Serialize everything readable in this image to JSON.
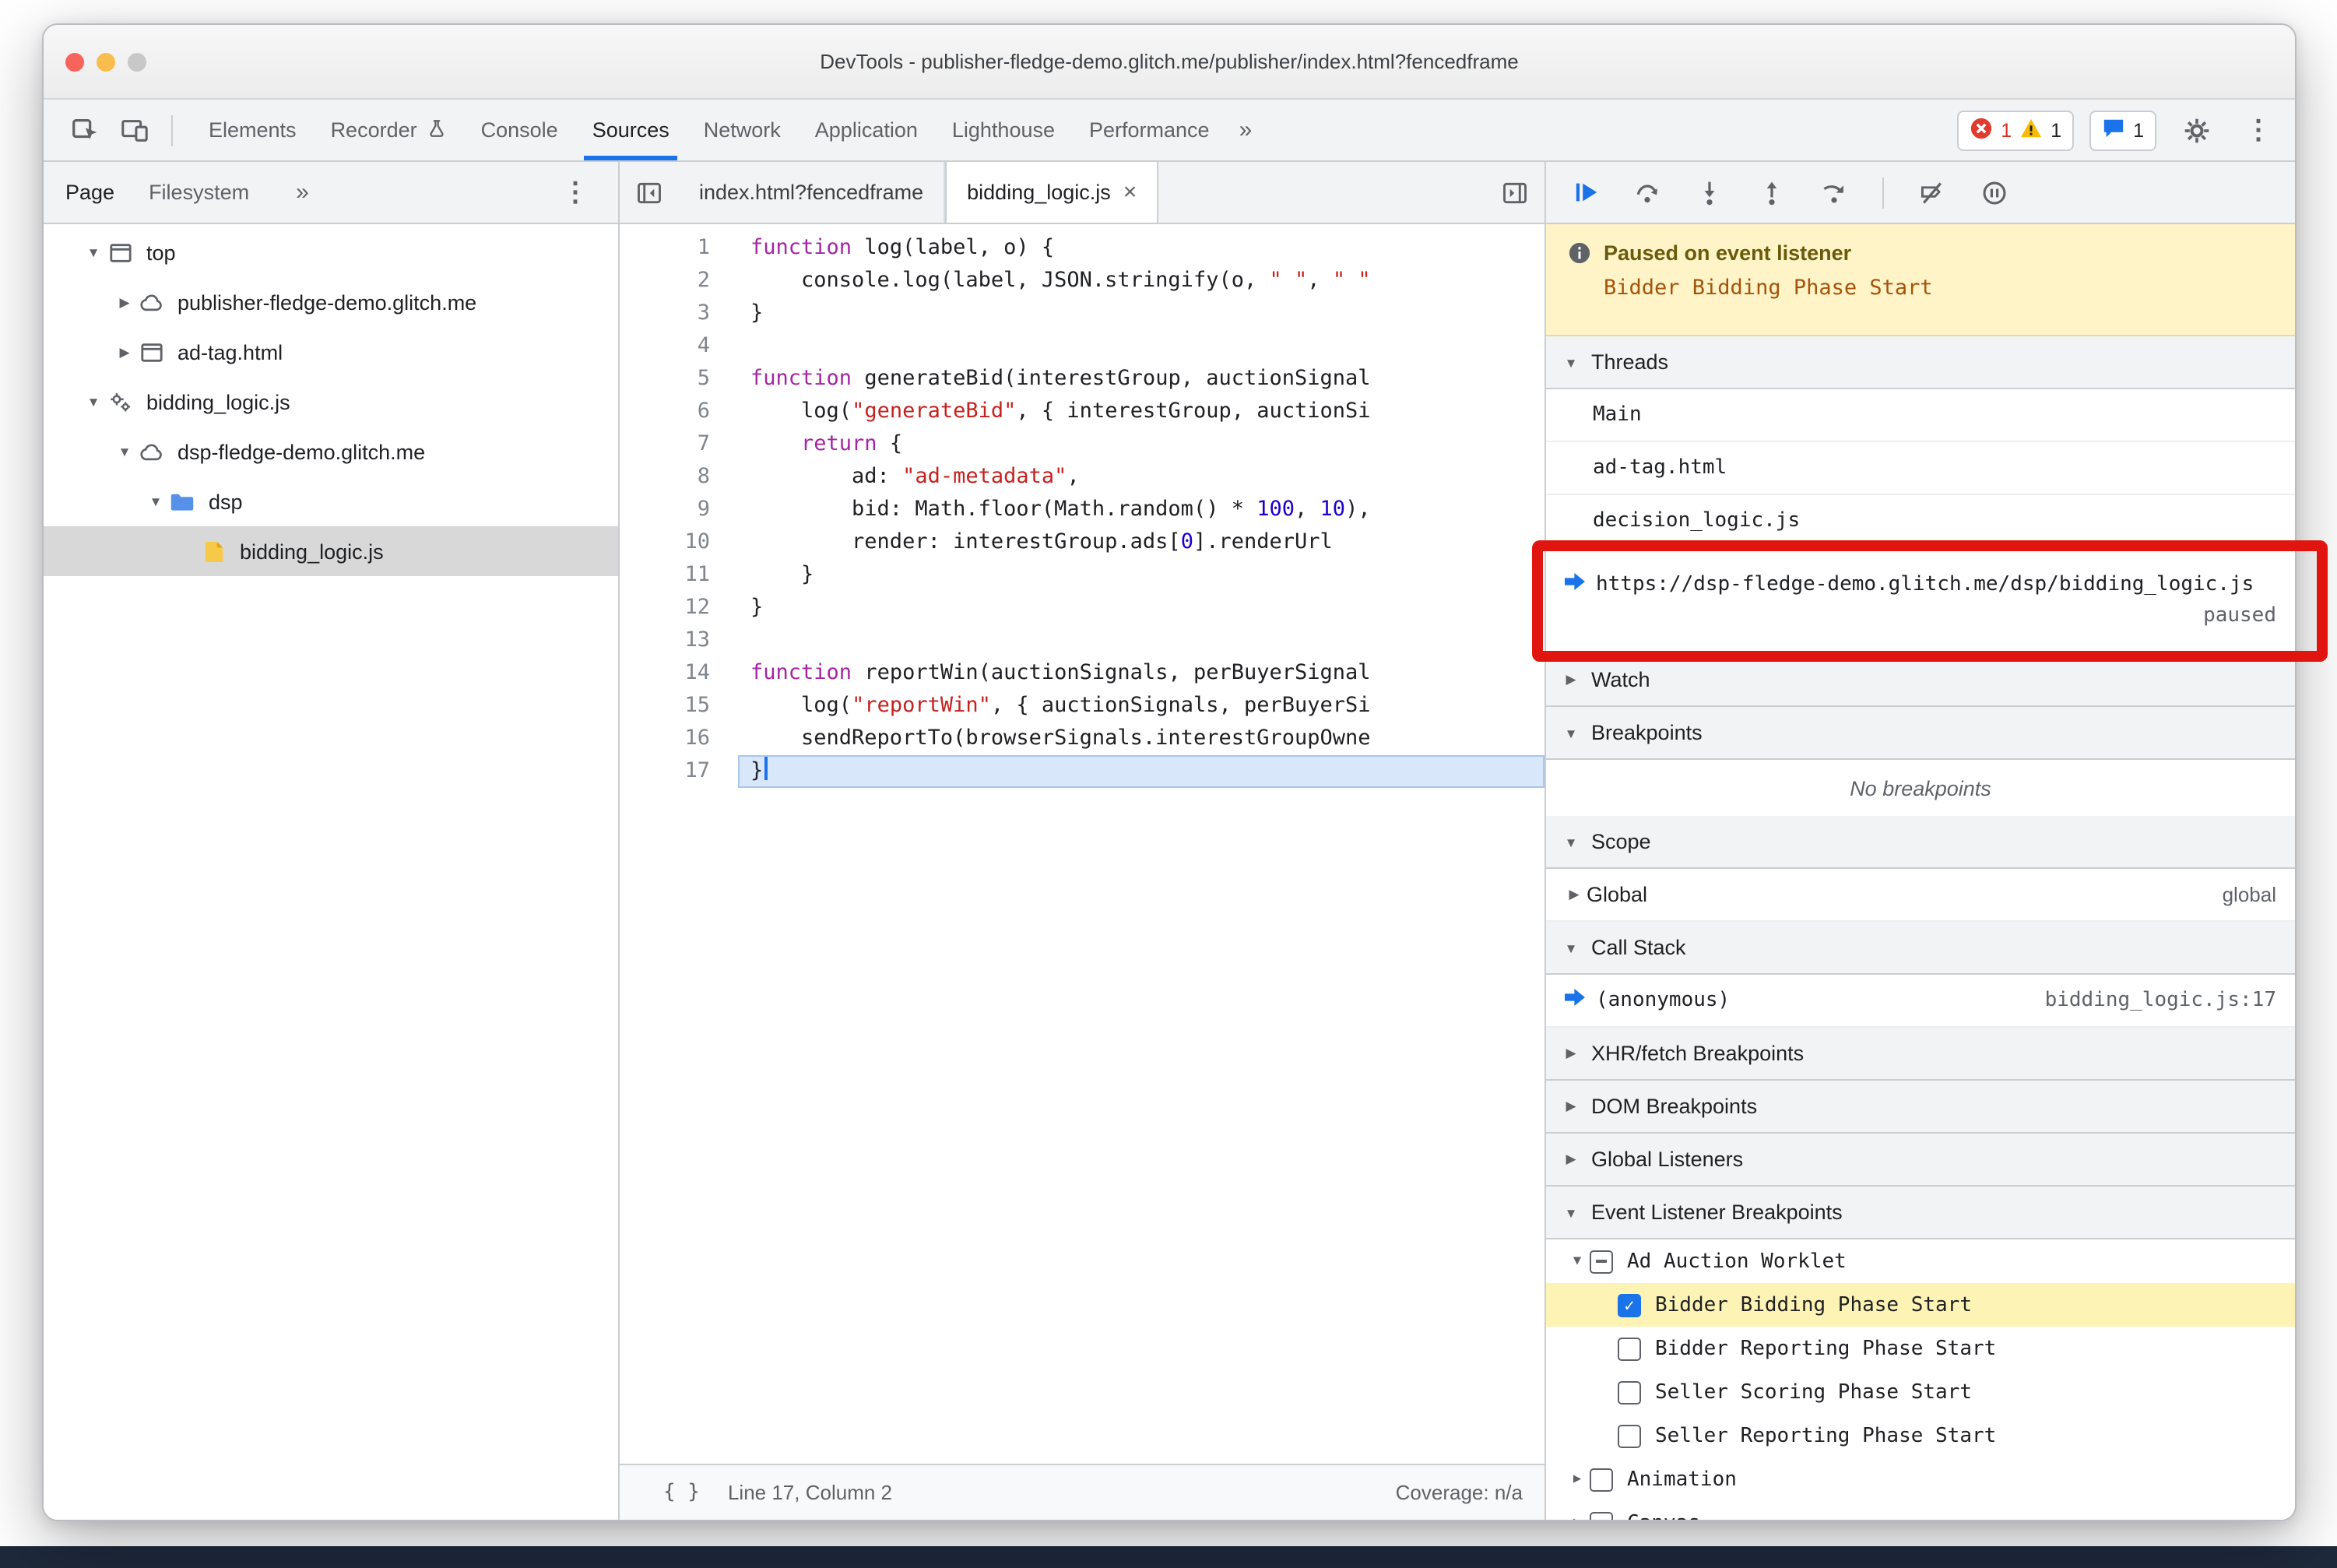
{
  "window": {
    "title": "DevTools - publisher-fledge-demo.glitch.me/publisher/index.html?fencedframe"
  },
  "colors": {
    "accent_blue": "#1a73e8",
    "annotation_red": "#e0150f",
    "paused_banner_bg": "#fff3c8",
    "listener_highlight": "#fdf3b4",
    "selection_gray": "#d8d8d8"
  },
  "main_toolbar": {
    "tabs": [
      {
        "label": "Elements"
      },
      {
        "label": "Recorder",
        "icon": "experiment-icon"
      },
      {
        "label": "Console"
      },
      {
        "label": "Sources",
        "selected": true
      },
      {
        "label": "Network"
      },
      {
        "label": "Application"
      },
      {
        "label": "Lighthouse"
      },
      {
        "label": "Performance"
      }
    ],
    "overflow_icon": "»",
    "errors_count": "1",
    "warnings_count": "1",
    "issues_count": "1",
    "menu_icon": "⋮"
  },
  "sidebar": {
    "tabs": [
      {
        "label": "Page",
        "selected": true
      },
      {
        "label": "Filesystem"
      }
    ],
    "more_icon": "»",
    "menu_icon": "⋮",
    "tree": [
      {
        "depth": 0,
        "disclosure": "expanded",
        "icon": "frame-icon",
        "label": "top"
      },
      {
        "depth": 1,
        "disclosure": "collapsed",
        "icon": "cloud-icon",
        "label": "publisher-fledge-demo.glitch.me"
      },
      {
        "depth": 1,
        "disclosure": "collapsed",
        "icon": "frame-icon",
        "label": "ad-tag.html"
      },
      {
        "depth": 0,
        "disclosure": "expanded",
        "icon": "worklet-icon",
        "label": "bidding_logic.js"
      },
      {
        "depth": 1,
        "disclosure": "expanded",
        "icon": "cloud-icon",
        "label": "dsp-fledge-demo.glitch.me"
      },
      {
        "depth": 2,
        "disclosure": "expanded",
        "icon": "folder-icon",
        "label": "dsp"
      },
      {
        "depth": 3,
        "disclosure": "none",
        "icon": "js-file-icon",
        "label": "bidding_logic.js",
        "selected": true
      }
    ]
  },
  "editor": {
    "tabs": [
      {
        "label": "index.html?fencedframe"
      },
      {
        "label": "bidding_logic.js",
        "active": true,
        "closable": true
      }
    ],
    "close_icon": "×",
    "active_line": 17,
    "lines": [
      [
        [
          "kw",
          "function"
        ],
        [
          "pl",
          " log(label, o) {"
        ]
      ],
      [
        [
          "pl",
          "    console.log(label, JSON.stringify(o, "
        ],
        [
          "str",
          "\" \""
        ],
        [
          "pl",
          ", "
        ],
        [
          "str",
          "\" \""
        ]
      ],
      [
        [
          "pl",
          "}"
        ]
      ],
      [],
      [
        [
          "kw",
          "function"
        ],
        [
          "pl",
          " generateBid(interestGroup, auctionSignal"
        ]
      ],
      [
        [
          "pl",
          "    log("
        ],
        [
          "str",
          "\"generateBid\""
        ],
        [
          "pl",
          ", { interestGroup, auctionSi"
        ]
      ],
      [
        [
          "pl",
          "    "
        ],
        [
          "kw",
          "return"
        ],
        [
          "pl",
          " {"
        ]
      ],
      [
        [
          "pl",
          "        ad: "
        ],
        [
          "str",
          "\"ad-metadata\""
        ],
        [
          "pl",
          ","
        ]
      ],
      [
        [
          "pl",
          "        bid: Math.floor(Math.random() * "
        ],
        [
          "num",
          "100"
        ],
        [
          "pl",
          ", "
        ],
        [
          "num",
          "10"
        ],
        [
          "pl",
          "),"
        ]
      ],
      [
        [
          "pl",
          "        render: interestGroup.ads["
        ],
        [
          "num",
          "0"
        ],
        [
          "pl",
          "].renderUrl"
        ]
      ],
      [
        [
          "pl",
          "    }"
        ]
      ],
      [
        [
          "pl",
          "}"
        ]
      ],
      [],
      [
        [
          "kw",
          "function"
        ],
        [
          "pl",
          " reportWin(auctionSignals, perBuyerSignal"
        ]
      ],
      [
        [
          "pl",
          "    log("
        ],
        [
          "str",
          "\"reportWin\""
        ],
        [
          "pl",
          ", { auctionSignals, perBuyerSi"
        ]
      ],
      [
        [
          "pl",
          "    sendReportTo(browserSignals.interestGroupOwne"
        ]
      ],
      [
        [
          "pl",
          "}"
        ]
      ]
    ],
    "status": {
      "format_icon": "{ }",
      "line_col": "Line 17, Column 2",
      "coverage": "Coverage: n/a"
    }
  },
  "debugger": {
    "toolbar_icons": [
      "resume-icon",
      "step-over-icon",
      "step-into-icon",
      "step-out-icon",
      "step-icon",
      "separator",
      "deactivate-breakpoints-icon",
      "pause-on-exceptions-icon"
    ],
    "paused_banner": {
      "title": "Paused on event listener",
      "detail": "Bidder Bidding Phase Start"
    },
    "sections": [
      {
        "title": "Threads",
        "state": "expanded",
        "kind": "threads",
        "rows": [
          {
            "label": "Main"
          },
          {
            "label": "ad-tag.html"
          },
          {
            "label": "decision_logic.js"
          },
          {
            "label": "https://dsp-fledge-demo.glitch.me/dsp/bidding_logic.js",
            "status": "paused",
            "current": true,
            "annotated": true
          }
        ]
      },
      {
        "title": "Watch",
        "state": "collapsed"
      },
      {
        "title": "Breakpoints",
        "state": "expanded",
        "kind": "empty",
        "empty_text": "No breakpoints"
      },
      {
        "title": "Scope",
        "state": "expanded",
        "kind": "scope",
        "rows": [
          {
            "label": "Global",
            "right": "global"
          }
        ]
      },
      {
        "title": "Call Stack",
        "state": "expanded",
        "kind": "callstack",
        "rows": [
          {
            "label": "(anonymous)",
            "right": "bidding_logic.js:17",
            "current": true
          }
        ]
      },
      {
        "title": "XHR/fetch Breakpoints",
        "state": "collapsed"
      },
      {
        "title": "DOM Breakpoints",
        "state": "collapsed"
      },
      {
        "title": "Global Listeners",
        "state": "collapsed"
      },
      {
        "title": "Event Listener Breakpoints",
        "state": "expanded",
        "kind": "listeners",
        "rows": [
          {
            "depth": 0,
            "disclosure": "expanded",
            "checkbox": "indeterminate",
            "label": "Ad Auction Worklet"
          },
          {
            "depth": 1,
            "checkbox": "checked",
            "label": "Bidder Bidding Phase Start",
            "highlighted": true
          },
          {
            "depth": 1,
            "checkbox": "unchecked",
            "label": "Bidder Reporting Phase Start"
          },
          {
            "depth": 1,
            "checkbox": "unchecked",
            "label": "Seller Scoring Phase Start"
          },
          {
            "depth": 1,
            "checkbox": "unchecked",
            "label": "Seller Reporting Phase Start"
          },
          {
            "depth": 0,
            "disclosure": "collapsed",
            "checkbox": "unchecked",
            "label": "Animation"
          },
          {
            "depth": 0,
            "disclosure": "collapsed",
            "checkbox": "unchecked",
            "label": "Canvas"
          }
        ]
      }
    ]
  }
}
